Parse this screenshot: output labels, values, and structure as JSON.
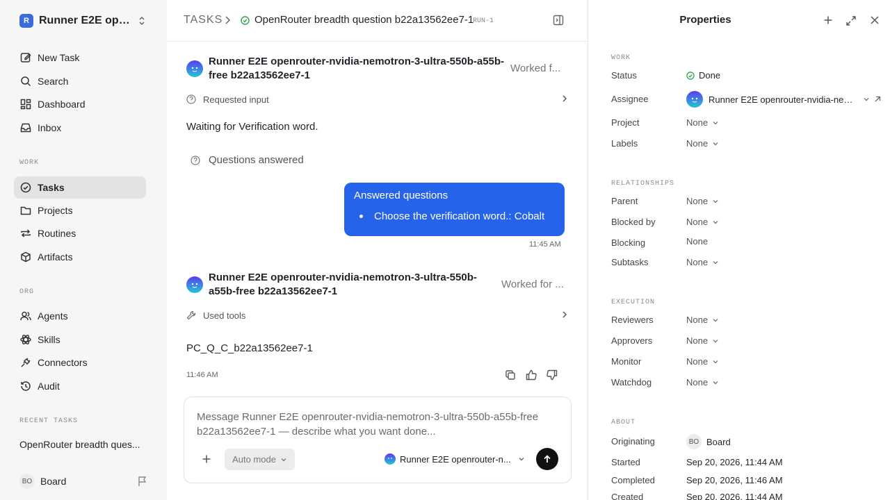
{
  "sidebar": {
    "workspace": "Runner E2E open...",
    "logo_letter": "R",
    "nav": [
      {
        "label": "New Task"
      },
      {
        "label": "Search"
      },
      {
        "label": "Dashboard"
      },
      {
        "label": "Inbox"
      }
    ],
    "work_label": "WORK",
    "work_items": [
      {
        "label": "Tasks"
      },
      {
        "label": "Projects"
      },
      {
        "label": "Routines"
      },
      {
        "label": "Artifacts"
      }
    ],
    "org_label": "ORG",
    "org_items": [
      {
        "label": "Agents"
      },
      {
        "label": "Skills"
      },
      {
        "label": "Connectors"
      },
      {
        "label": "Audit"
      }
    ],
    "recent_label": "RECENT TASKS",
    "recent_task": "OpenRouter breadth ques...",
    "user_initials": "BO",
    "user_name": "Board"
  },
  "header": {
    "root": "TASKS",
    "title": "OpenRouter breadth question b22a13562ee7-1",
    "run": "RUN-1"
  },
  "thread": {
    "msg1_agent_line1": "Runner E2E openrouter-nvidia-nemotron-3-ultra-550b-a55b-",
    "msg1_agent_line2": "free b22a13562ee7-1",
    "msg1_worked": "Worked f...",
    "msg1_tool": "Requested input",
    "msg1_text": "Waiting for Verification word.",
    "qa_label": "Questions answered",
    "bubble_title": "Answered questions",
    "bubble_item": "Choose the verification word.: Cobalt",
    "bubble_time": "11:45 AM",
    "msg2_agent_line1": "Runner E2E openrouter-nvidia-nemotron-3-ultra-550b-",
    "msg2_agent_line2": "a55b-free b22a13562ee7-1",
    "msg2_worked": "Worked for ...",
    "msg2_tool": "Used tools",
    "msg2_text": "PC_Q_C_b22a13562ee7-1",
    "msg2_time": "11:46 AM"
  },
  "composer": {
    "placeholder": "Message Runner E2E openrouter-nvidia-nemotron-3-ultra-550b-a55b-free b22a13562ee7-1 — describe what you want done...",
    "mode": "Auto mode",
    "agent": "Runner E2E openrouter-n..."
  },
  "properties": {
    "title": "Properties",
    "work_label": "WORK",
    "status_label": "Status",
    "status_value": "Done",
    "assignee_label": "Assignee",
    "assignee_value": "Runner E2E openrouter-nvidia-nem...",
    "project_label": "Project",
    "project_value": "None",
    "labels_label": "Labels",
    "labels_value": "None",
    "rel_label": "RELATIONSHIPS",
    "parent_label": "Parent",
    "parent_value": "None",
    "blocked_label": "Blocked by",
    "blocked_value": "None",
    "blocking_label": "Blocking",
    "blocking_value": "None",
    "subtasks_label": "Subtasks",
    "subtasks_value": "None",
    "exec_label": "EXECUTION",
    "reviewers_label": "Reviewers",
    "reviewers_value": "None",
    "approvers_label": "Approvers",
    "approvers_value": "None",
    "monitor_label": "Monitor",
    "monitor_value": "None",
    "watchdog_label": "Watchdog",
    "watchdog_value": "None",
    "about_label": "ABOUT",
    "originating_label": "Originating",
    "originating_initials": "BO",
    "originating_value": "Board",
    "started_label": "Started",
    "started_value": "Sep 20, 2026, 11:44 AM",
    "completed_label": "Completed",
    "completed_value": "Sep 20, 2026, 11:46 AM",
    "created_label": "Created",
    "created_value": "Sep 20, 2026, 11:44 AM"
  },
  "colors": {
    "accent": "#2563eb",
    "done": "#2da44e",
    "sidebar_bg": "#f6f6f6"
  }
}
